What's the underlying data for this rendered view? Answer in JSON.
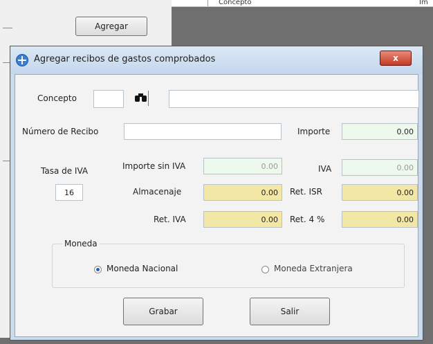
{
  "background": {
    "header_col1": "Concepto",
    "header_col2": "Im",
    "agregar_button": "Agregar"
  },
  "dialog": {
    "title": "Agregar recibos de gastos comprobados",
    "close_symbol": "x",
    "concepto_label": "Concepto",
    "concepto_code": "",
    "concepto_desc": "",
    "numero_recibo_label": "Número de Recibo",
    "numero_recibo_value": "",
    "importe_label": "Importe",
    "importe_value": "0.00",
    "tasa_iva_label": "Tasa de IVA",
    "tasa_iva_value": "16",
    "importe_sin_iva_label": "Importe sin IVA",
    "importe_sin_iva_value": "0.00",
    "iva_label": "IVA",
    "iva_value": "0.00",
    "almacenaje_label": "Almacenaje",
    "almacenaje_value": "0.00",
    "ret_isr_label": "Ret. ISR",
    "ret_isr_value": "0.00",
    "ret_iva_label": "Ret. IVA",
    "ret_iva_value": "0.00",
    "ret_4_label": "Ret. 4 %",
    "ret_4_value": "0.00",
    "moneda_label": "Moneda",
    "moneda_nacional_label": "Moneda Nacional",
    "moneda_extranjera_label": "Moneda Extranjera",
    "selected_currency": "Moneda Nacional",
    "grabar_label": "Grabar",
    "salir_label": "Salir"
  },
  "colors": {
    "titlebar": "#c9dbed",
    "close_button": "#c23a22",
    "highlight_field": "#f2e7a4",
    "green_field": "#eef9ee"
  },
  "icons": [
    "add-icon",
    "binoculars-icon",
    "close-icon"
  ]
}
